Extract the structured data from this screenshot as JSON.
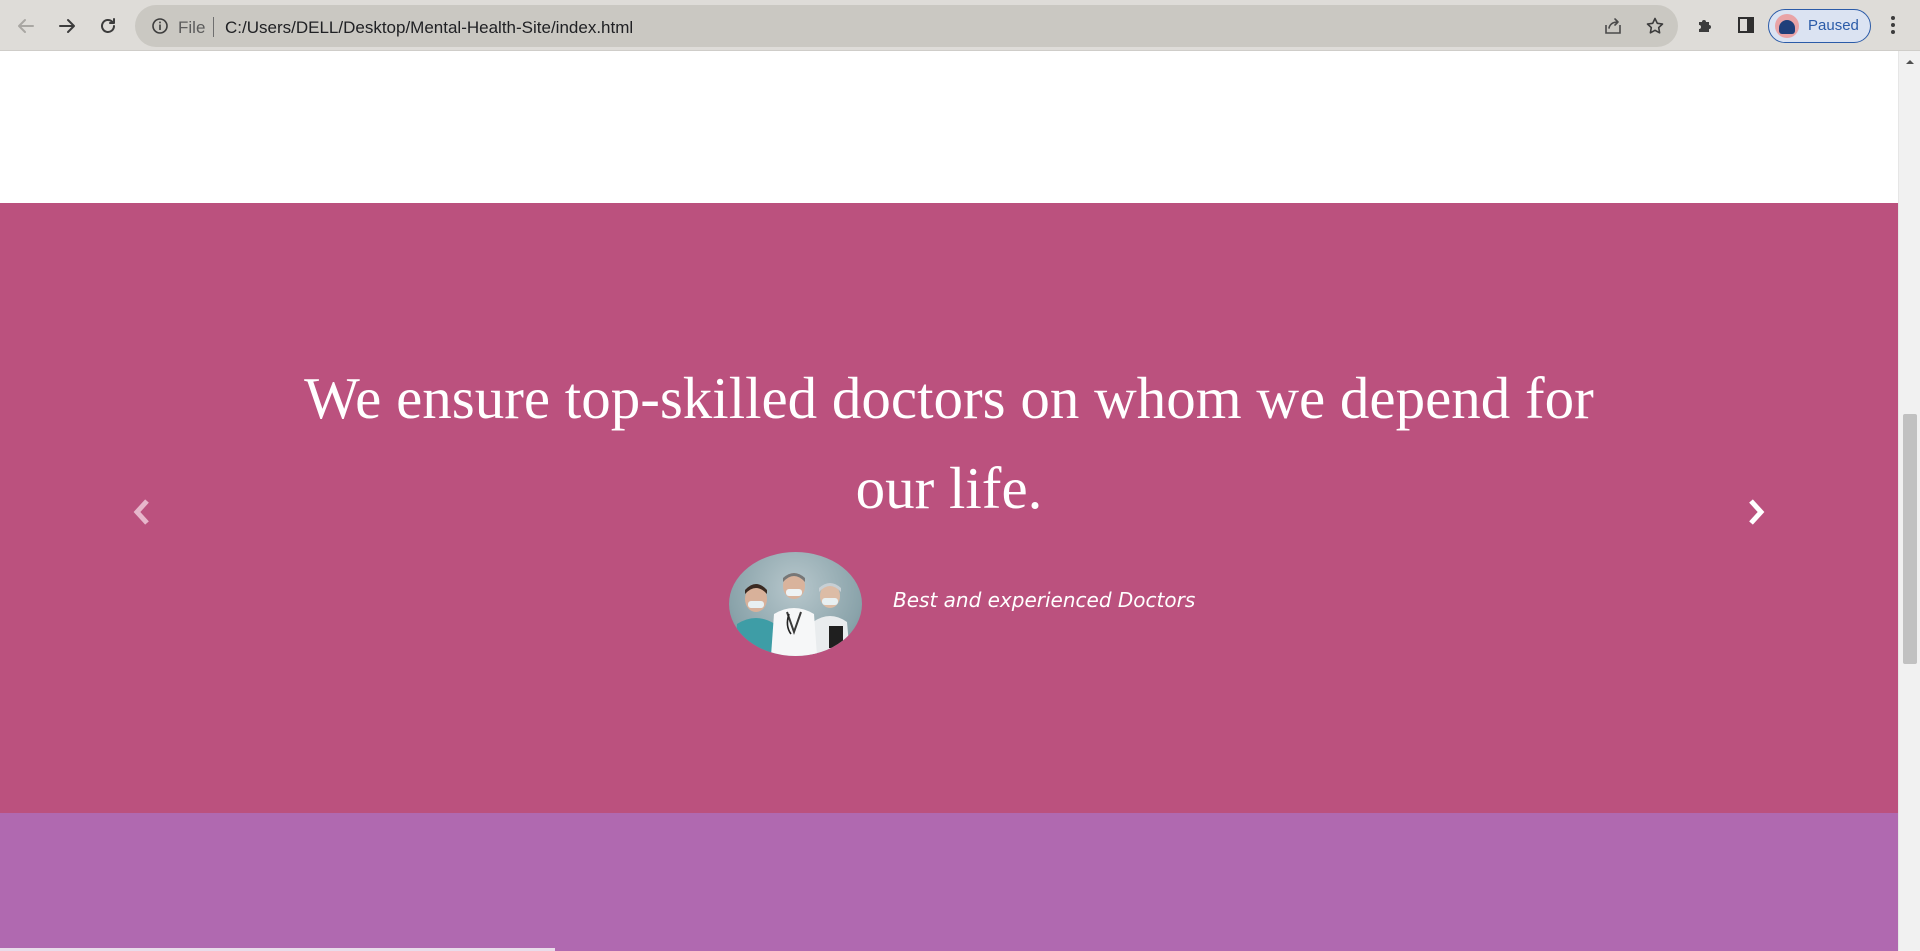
{
  "browser": {
    "omnibox": {
      "scheme_label": "File",
      "url": "C:/Users/DELL/Desktop/Mental-Health-Site/index.html"
    },
    "profile": {
      "status": "Paused"
    }
  },
  "hero": {
    "quote": "We ensure top-skilled doctors on whom we depend for our life.",
    "caption": "Best and experienced Doctors"
  },
  "colors": {
    "hero_bg": "#bb517e",
    "next_section_bg": "#b069b0",
    "profile_accent": "#2b5ba8"
  },
  "icons": {
    "back": "arrow-left-icon",
    "forward": "arrow-right-icon",
    "reload": "reload-icon",
    "site_info": "info-icon",
    "share": "share-icon",
    "bookmark": "star-icon",
    "extensions": "puzzle-icon",
    "side_panel": "side-panel-icon",
    "menu": "kebab-menu-icon",
    "carousel_prev": "chevron-left-icon",
    "carousel_next": "chevron-right-icon"
  }
}
